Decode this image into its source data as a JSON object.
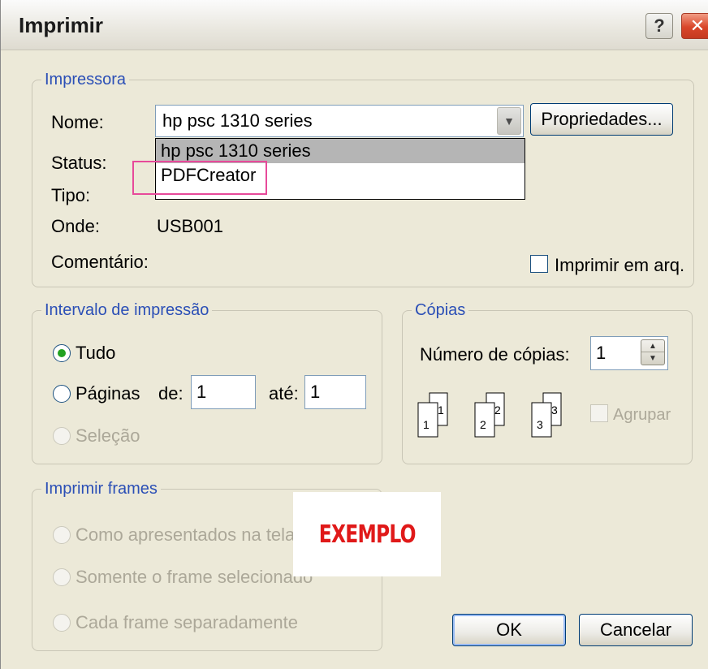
{
  "window": {
    "title": "Imprimir",
    "help_glyph": "?",
    "close_glyph": "✕"
  },
  "printer": {
    "legend": "Impressora",
    "name_label": "Nome:",
    "selected_printer": "hp psc 1310 series",
    "dropdown_options": [
      "hp psc 1310 series",
      "PDFCreator"
    ],
    "properties_button": "Propriedades...",
    "status_label": "Status:",
    "type_label": "Tipo:",
    "where_label": "Onde:",
    "where_value": "USB001",
    "comment_label": "Comentário:",
    "print_to_file_label": "Imprimir em arq."
  },
  "range": {
    "legend": "Intervalo de impressão",
    "all_label": "Tudo",
    "pages_label": "Páginas",
    "from_label": "de:",
    "from_value": "1",
    "to_label": "até:",
    "to_value": "1",
    "selection_label": "Seleção"
  },
  "copies": {
    "legend": "Cópias",
    "count_label": "Número de cópias:",
    "count_value": "1",
    "collate_label": "Agrupar",
    "collate_icons": [
      [
        "1",
        "1"
      ],
      [
        "2",
        "2"
      ],
      [
        "3",
        "3"
      ]
    ]
  },
  "frames": {
    "legend": "Imprimir frames",
    "options": [
      "Como apresentados na tela",
      "Somente o frame selecionado",
      "Cada frame separadamente"
    ]
  },
  "buttons": {
    "ok": "OK",
    "cancel": "Cancelar"
  },
  "watermark": "EXEMPLO",
  "colors": {
    "legend_blue": "#2b4fb6",
    "watermark_red": "#e01919",
    "highlight_pink": "#e74a9a"
  }
}
